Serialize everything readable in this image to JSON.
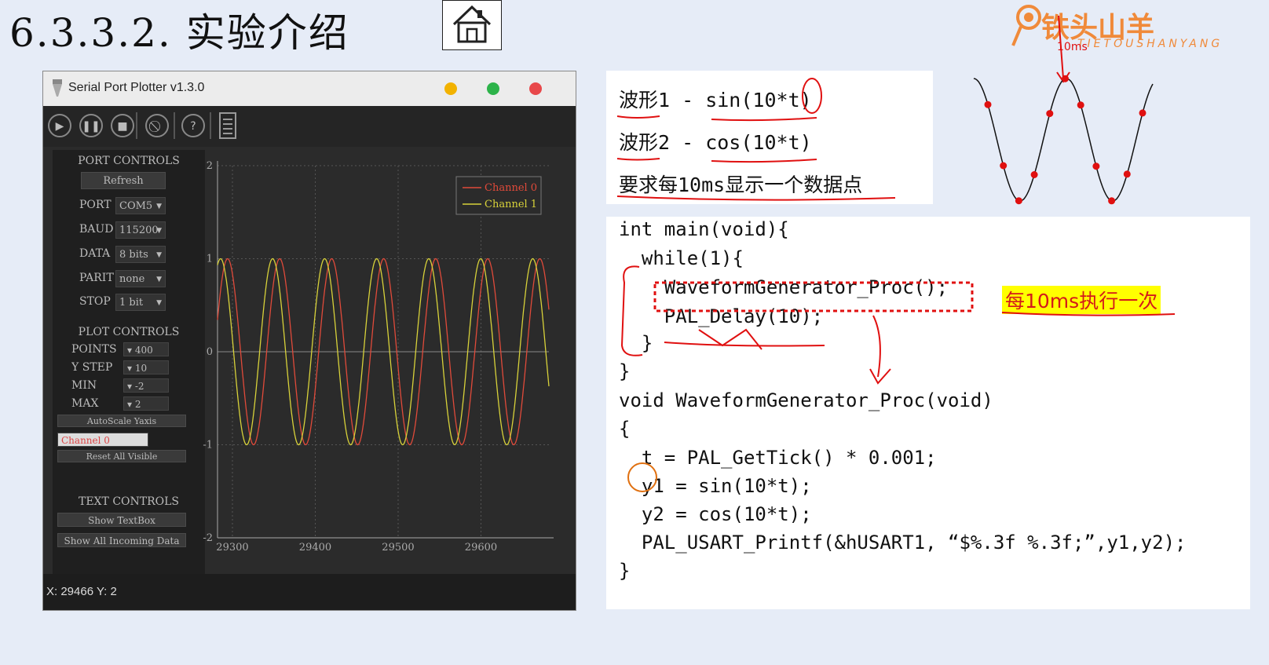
{
  "slide": {
    "title": "6.3.3.2. 实验介绍"
  },
  "logo": {
    "main": "铁头山羊",
    "sub": "TIETOUSHANYANG"
  },
  "plotter": {
    "window_title": "Serial Port Plotter v1.3.0",
    "window_buttons": {
      "minimize_color": "#f2b200",
      "maximize_color": "#2db34a",
      "close_color": "#e8484a"
    },
    "toolbar_icons": [
      "play-icon",
      "pause-icon",
      "stop-icon",
      "clear-icon",
      "help-icon",
      "document-icon"
    ],
    "port_controls": {
      "heading": "PORT CONTROLS",
      "refresh_label": "Refresh",
      "port_label": "PORT",
      "port_value": "COM5",
      "baud_label": "BAUD",
      "baud_value": "115200",
      "data_label": "DATA",
      "data_value": "8 bits",
      "parity_label": "PARITY",
      "parity_value": "none",
      "stop_label": "STOP",
      "stop_value": "1 bit"
    },
    "plot_controls": {
      "heading": "PLOT CONTROLS",
      "points_label": "POINTS",
      "points_value": "400",
      "ystep_label": "Y STEP",
      "ystep_value": "10",
      "min_label": "MIN",
      "min_value": "-2",
      "max_label": "MAX",
      "max_value": "2",
      "autoscale_label": "AutoScale Yaxis",
      "channel_value": "Channel 0",
      "reset_visible_label": "Reset All Visible"
    },
    "text_controls": {
      "heading": "TEXT CONTROLS",
      "show_textbox_label": "Show TextBox",
      "show_all_label": "Show All Incoming Data"
    },
    "status": "X: 29466 Y: 2"
  },
  "chart_data": {
    "type": "line",
    "title": "",
    "xlabel": "",
    "ylabel": "",
    "xlim": [
      29282,
      29682
    ],
    "ylim": [
      -2,
      2
    ],
    "x_ticks": [
      29300,
      29400,
      29500,
      29600
    ],
    "y_ticks": [
      2,
      1,
      0,
      -1,
      -2
    ],
    "grid": true,
    "legend_position": "top-right",
    "series": [
      {
        "name": "Channel 0",
        "color": "#e04a3a",
        "function": "sin(10*t)",
        "period": 62.8,
        "amplitude": 1,
        "phase_deg": 0
      },
      {
        "name": "Channel 1",
        "color": "#d8d23a",
        "function": "cos(10*t)",
        "period": 62.8,
        "amplitude": 1,
        "phase_deg": 90
      }
    ]
  },
  "waves": {
    "line1": "波形1 - sin(10*t)",
    "line2": "波形2 - cos(10*t)",
    "line3": "要求每10ms显示一个数据点"
  },
  "code": {
    "lines": [
      "int main(void){",
      "  while(1){",
      "    WaveformGenerator_Proc();",
      "    PAL_Delay(10);",
      "  }",
      "}",
      "void WaveformGenerator_Proc(void)",
      "{",
      "  t = PAL_GetTick() * 0.001;",
      "  y1 = sin(10*t);",
      "  y2 = cos(10*t);",
      "  PAL_USART_Printf(&hUSART1, “$%.3f %.3f;”,y1,y2);",
      "}"
    ],
    "note": "每10ms执行一次"
  },
  "annotations": {
    "ink_color": "#e01010",
    "dot_color": "#e01010",
    "handwritten_label": "10ms"
  }
}
